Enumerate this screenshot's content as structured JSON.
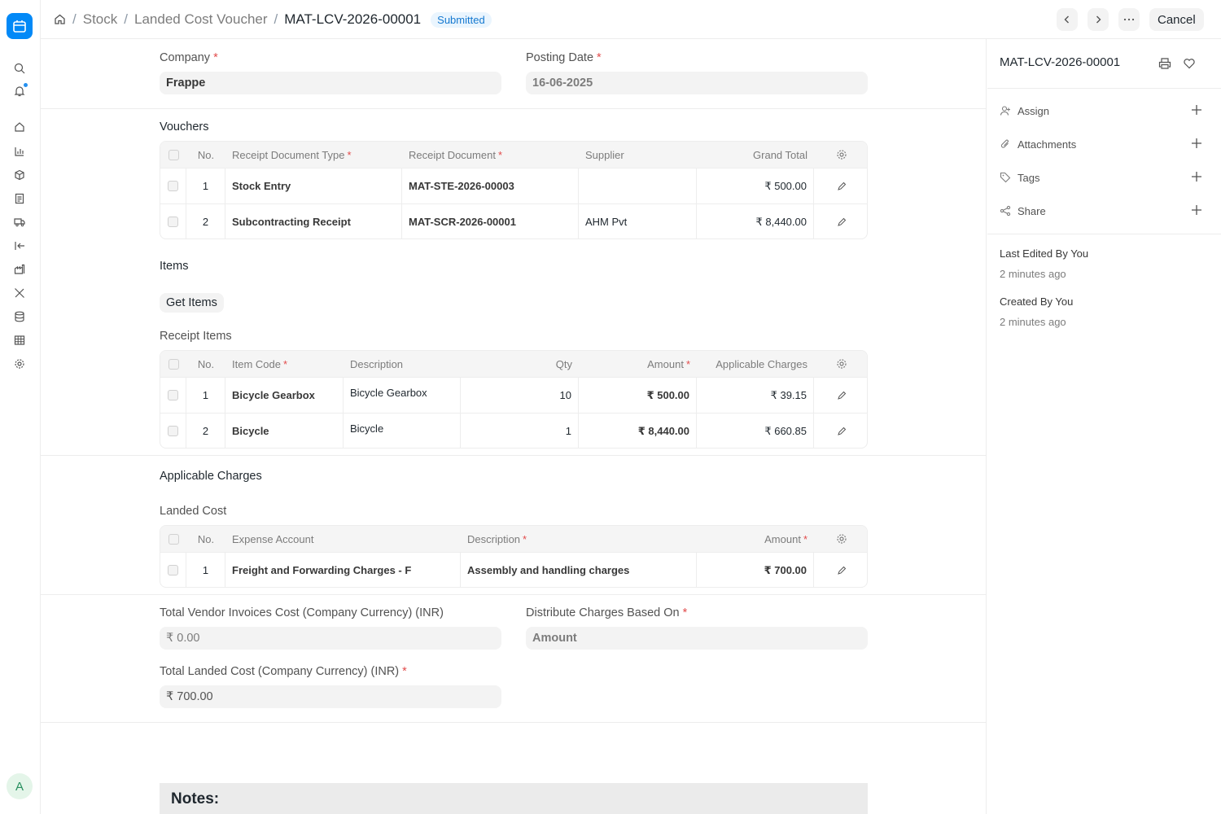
{
  "breadcrumb": {
    "items": [
      "Stock",
      "Landed Cost Voucher"
    ],
    "current": "MAT-LCV-2026-00001",
    "status": "Submitted"
  },
  "toolbar": {
    "cancel_label": "Cancel"
  },
  "form": {
    "company_label": "Company",
    "company_value": "Frappe",
    "posting_date_label": "Posting Date",
    "posting_date_value": "16-06-2025",
    "vouchers_title": "Vouchers",
    "items_title": "Items",
    "get_items_label": "Get Items",
    "receipt_items_title": "Receipt Items",
    "applicable_charges_title": "Applicable Charges",
    "landed_cost_title": "Landed Cost",
    "total_vendor_label": "Total Vendor Invoices Cost (Company Currency) (INR)",
    "total_vendor_value": "₹ 0.00",
    "distribute_label": "Distribute Charges Based On",
    "distribute_value": "Amount",
    "total_landed_label": "Total Landed Cost (Company Currency) (INR)",
    "total_landed_value": "₹ 700.00",
    "notes_label": "Notes:"
  },
  "vouchers": {
    "headers": [
      "No.",
      "Receipt Document Type",
      "Receipt Document",
      "Supplier",
      "Grand Total"
    ],
    "rows": [
      {
        "no": "1",
        "type": "Stock Entry",
        "doc": "MAT-STE-2026-00003",
        "supplier": "",
        "total": "₹ 500.00"
      },
      {
        "no": "2",
        "type": "Subcontracting Receipt",
        "doc": "MAT-SCR-2026-00001",
        "supplier": "AHM Pvt",
        "total": "₹ 8,440.00"
      }
    ]
  },
  "receipt_items": {
    "headers": [
      "No.",
      "Item Code",
      "Description",
      "Qty",
      "Amount",
      "Applicable Charges"
    ],
    "rows": [
      {
        "no": "1",
        "code": "Bicycle Gearbox",
        "desc": "Bicycle Gearbox",
        "qty": "10",
        "amount": "₹ 500.00",
        "charges": "₹ 39.15"
      },
      {
        "no": "2",
        "code": "Bicycle",
        "desc": "Bicycle",
        "qty": "1",
        "amount": "₹ 8,440.00",
        "charges": "₹ 660.85"
      }
    ]
  },
  "landed_cost": {
    "headers": [
      "No.",
      "Expense Account",
      "Description",
      "Amount"
    ],
    "rows": [
      {
        "no": "1",
        "account": "Freight and Forwarding Charges - F",
        "desc": "Assembly and handling charges",
        "amount": "₹ 700.00"
      }
    ]
  },
  "sidebar": {
    "doc_name": "MAT-LCV-2026-00001",
    "actions": [
      "Assign",
      "Attachments",
      "Tags",
      "Share"
    ],
    "last_edited": "Last Edited By You",
    "last_edited_time": "2 minutes ago",
    "created": "Created By You",
    "created_time": "2 minutes ago"
  },
  "user": {
    "avatar_initial": "A"
  },
  "colors": {
    "accent": "#0289f7",
    "required": "#e24c4c",
    "badge_text": "#1579d0"
  }
}
